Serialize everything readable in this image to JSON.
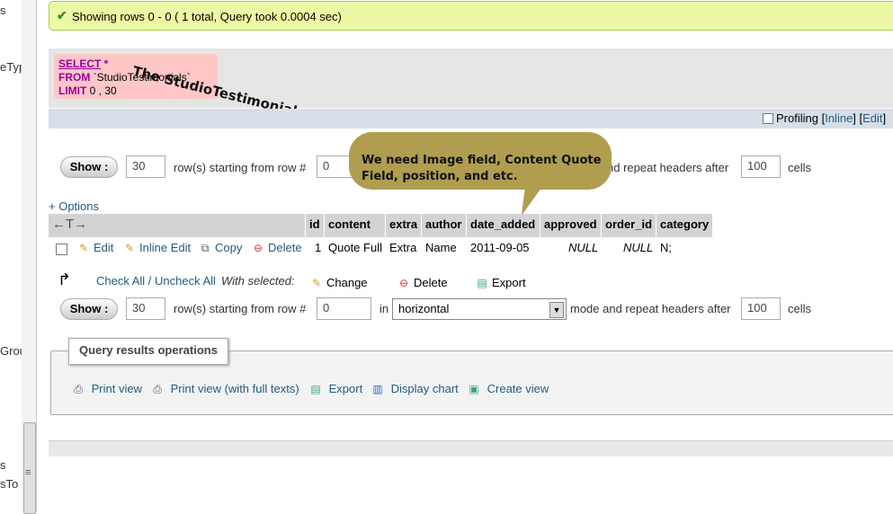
{
  "sidebar_fragments": [
    "s",
    "eTyp",
    "Grou",
    "s",
    "sTo"
  ],
  "scroll_grip": "≡",
  "success": {
    "icon": "check-icon",
    "text": "Showing rows 0 - 0 ( 1 total, Query took 0.0004 sec)"
  },
  "sql": {
    "select_kw": "SELECT",
    "select_rest": " *",
    "from_kw": "FROM",
    "from_rest": " `StudioTestimonials`",
    "limit_kw": "LIMIT",
    "limit_rest": " 0 , 30"
  },
  "annotation_title": "The StudioTestimonials Table",
  "profiling": {
    "label": "Profiling",
    "inline": "Inline",
    "edit": "Edit",
    "open": "[",
    "sep": "] [",
    "close": "]"
  },
  "nav_top": {
    "show_label": "Show :",
    "rows_value": "30",
    "rows_text": "row(s) starting from row #",
    "start_value": "0",
    "repeat_text": "nd repeat headers after",
    "headers_value": "100",
    "cells_text": "cells"
  },
  "bubble_text": "We need Image field, Content Quote Field, position, and etc.",
  "options_label": "+ Options",
  "table": {
    "arrows": "←T→",
    "columns": [
      "id",
      "content",
      "extra",
      "author",
      "date_added",
      "approved",
      "order_id",
      "category"
    ],
    "row": {
      "edit": "Edit",
      "inline_edit": "Inline Edit",
      "copy": "Copy",
      "delete": "Delete",
      "cells": [
        "1",
        "Quote Full",
        "Extra",
        "Name",
        "2011-09-05",
        "NULL",
        "NULL",
        "N;"
      ]
    }
  },
  "with_selected": {
    "check_all": "Check All / Uncheck All",
    "label": "With selected:",
    "change": "Change",
    "delete": "Delete",
    "export": "Export"
  },
  "nav_bottom": {
    "show_label": "Show :",
    "rows_value": "30",
    "rows_text": "row(s) starting from row #",
    "start_value": "0",
    "in_text": "in",
    "mode_value": "horizontal",
    "mode_text": "mode and repeat headers after",
    "headers_value": "100",
    "cells_text": "cells"
  },
  "ops": {
    "legend": "Query results operations",
    "print_view": "Print view",
    "print_full": "Print view (with full texts)",
    "export": "Export",
    "display_chart": "Display chart",
    "create_view": "Create view"
  },
  "colors": {
    "link": "#235a81",
    "success_bg": "#ebf8a4",
    "bubble": "#b09d4f",
    "sql_bg": "#ffc7c7"
  }
}
